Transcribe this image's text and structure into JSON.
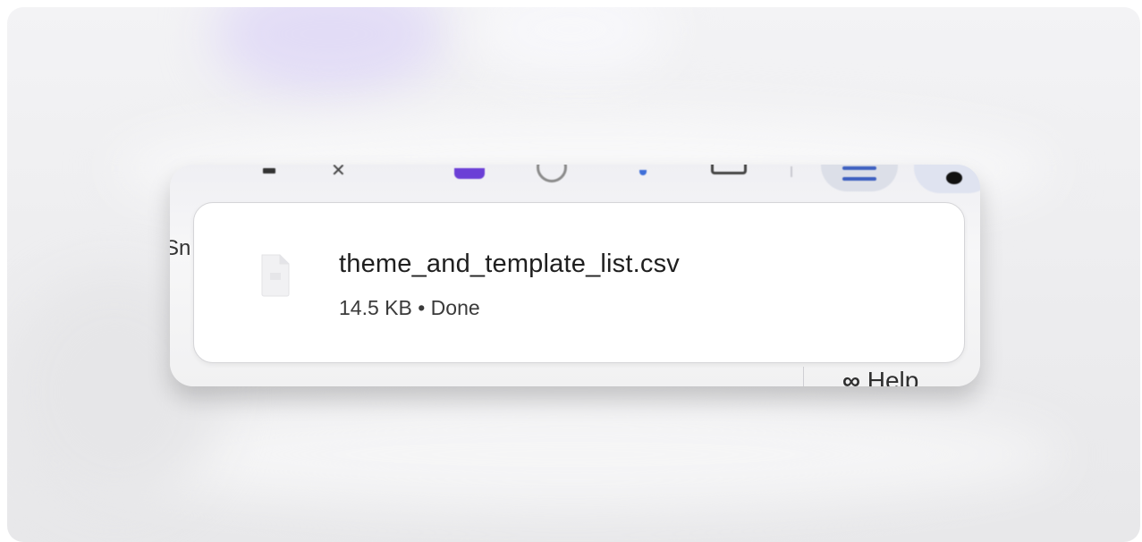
{
  "download": {
    "file_name": "theme_and_template_list.csv",
    "status_line": "14.5 KB • Done",
    "file_icon": "file-icon"
  },
  "background": {
    "partial_left_text": "Sn",
    "help_label": "Help",
    "help_icon": "infinity-icon"
  },
  "toolbar_icons": [
    "bookmark-icon",
    "star-icon",
    "extension-icon",
    "accessibility-icon",
    "download-icon",
    "window-icon",
    "menu-icon",
    "profile-avatar"
  ],
  "colors": {
    "accent_blue": "#3d5fc0",
    "extension_purple": "#6b3fd6"
  }
}
